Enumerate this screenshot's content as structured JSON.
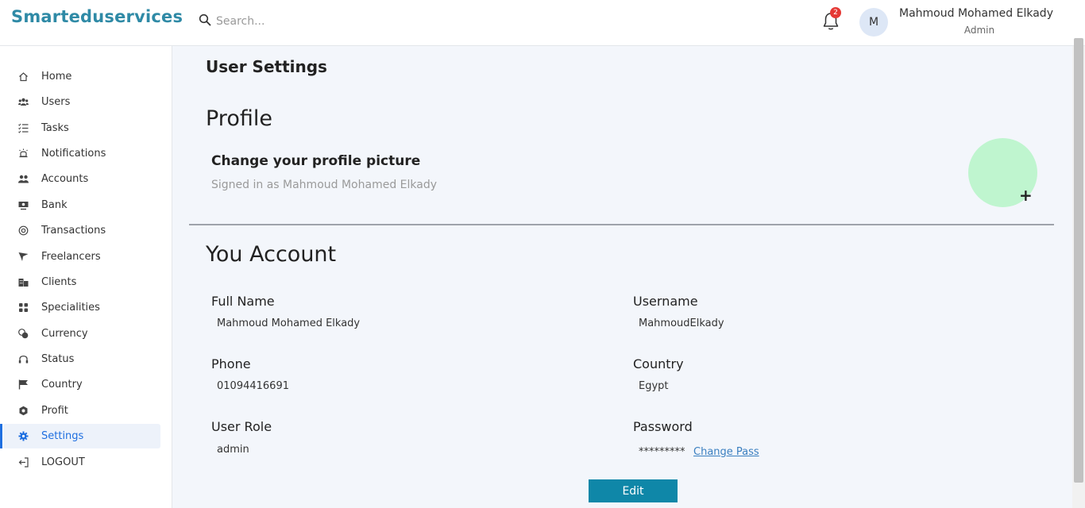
{
  "header": {
    "brand": "Smarteduservices",
    "search_placeholder": "Search...",
    "notification_count": "2",
    "avatar_initial": "M",
    "user_name": "Mahmoud Mohamed Elkady",
    "user_role": "Admin"
  },
  "sidebar": {
    "items": [
      {
        "label": "Home",
        "icon": "home-icon"
      },
      {
        "label": "Users",
        "icon": "users-icon"
      },
      {
        "label": "Tasks",
        "icon": "tasks-icon"
      },
      {
        "label": "Notifications",
        "icon": "alarm-icon"
      },
      {
        "label": "Accounts",
        "icon": "accounts-icon"
      },
      {
        "label": "Bank",
        "icon": "bank-icon"
      },
      {
        "label": "Transactions",
        "icon": "transactions-icon"
      },
      {
        "label": "Freelancers",
        "icon": "freelancers-icon"
      },
      {
        "label": "Clients",
        "icon": "clients-icon"
      },
      {
        "label": "Specialities",
        "icon": "grid-icon"
      },
      {
        "label": "Currency",
        "icon": "currency-icon"
      },
      {
        "label": "Status",
        "icon": "status-icon"
      },
      {
        "label": "Country",
        "icon": "flag-icon"
      },
      {
        "label": "Profit",
        "icon": "profit-icon"
      },
      {
        "label": "Settings",
        "icon": "gear-icon",
        "active": true
      },
      {
        "label": "LOGOUT",
        "icon": "logout-icon"
      }
    ]
  },
  "main": {
    "page_title": "User Settings",
    "profile": {
      "title": "Profile",
      "picture_title": "Change your profile picture",
      "picture_subtitle": "Signed in as Mahmoud Mohamed Elkady",
      "add_symbol": "+"
    },
    "account": {
      "title": "You Account",
      "full_name_label": "Full Name",
      "full_name": "Mahmoud Mohamed Elkady",
      "username_label": "Username",
      "username": "MahmoudElkady",
      "phone_label": "Phone",
      "phone": "01094416691",
      "country_label": "Country",
      "country": "Egypt",
      "role_label": "User Role",
      "role": "admin",
      "password_label": "Password",
      "password": "*********",
      "change_pass": "Change Pass",
      "edit_button": "Edit"
    }
  },
  "colors": {
    "brand": "#2f8aa6",
    "active": "#1f6fe0",
    "edit_button": "#0f87a8",
    "avatar_circle": "#bff5cf",
    "badge": "#e53935"
  }
}
